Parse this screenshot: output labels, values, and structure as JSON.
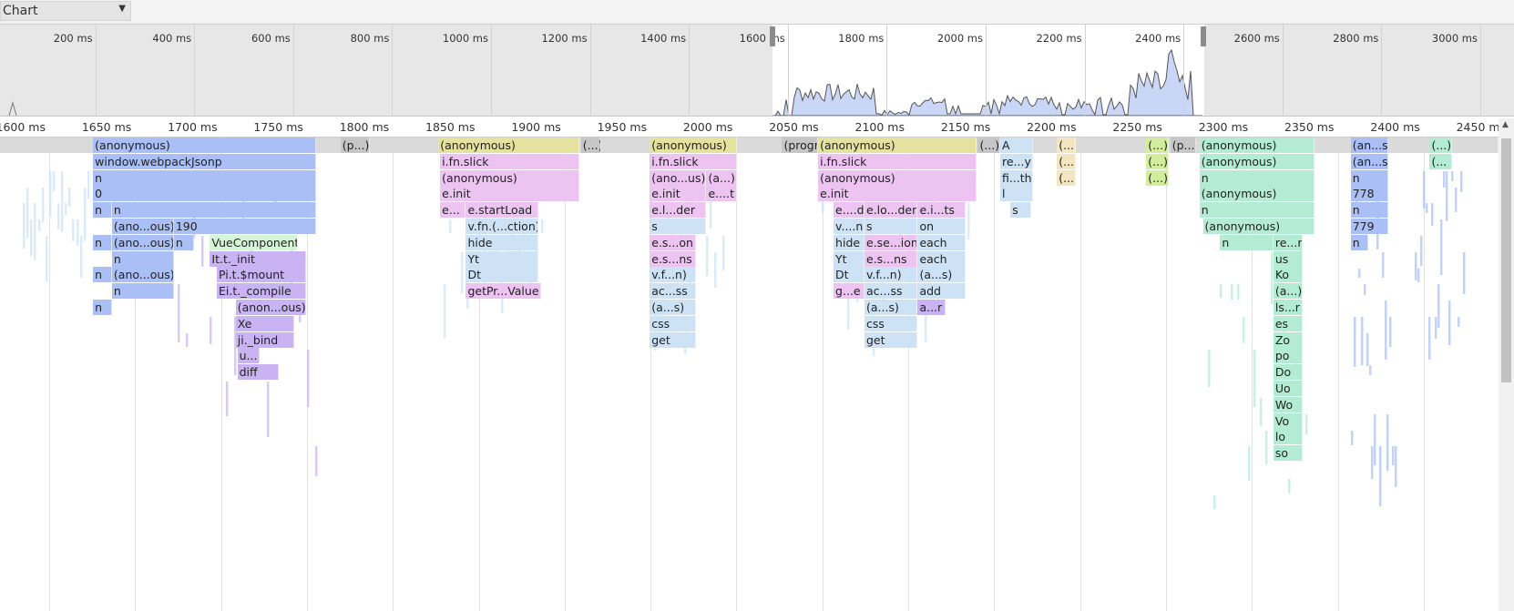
{
  "view_selector": {
    "label": "Chart",
    "icon": "dropdown-triangle-icon"
  },
  "overview": {
    "ticks": [
      "200 ms",
      "400 ms",
      "600 ms",
      "800 ms",
      "1000 ms",
      "1200 ms",
      "1400 ms",
      "1600 ms",
      "1800 ms",
      "2000 ms",
      "2200 ms",
      "2400 ms",
      "2600 ms",
      "2800 ms",
      "3000 ms"
    ],
    "selection_ms": [
      1630,
      2460
    ]
  },
  "ruler": {
    "ticks": [
      "1600 ms",
      "1650 ms",
      "1700 ms",
      "1750 ms",
      "1800 ms",
      "1850 ms",
      "1900 ms",
      "1950 ms",
      "2000 ms",
      "2050 ms",
      "2100 ms",
      "2150 ms",
      "2200 ms",
      "2250 ms",
      "2300 ms",
      "2350 ms",
      "2400 ms",
      "2450 ms"
    ]
  },
  "colors": {
    "blue": "#a9bff5",
    "purple": "#c9b3f2",
    "yellow": "#e5e2a0",
    "pink": "#edc3f2",
    "lightblue": "#cde3f5",
    "gray": "#c6c6c6",
    "green": "#b3ebd4",
    "mint": "#d6f5d6",
    "lime": "#d2ee9c",
    "tan": "#f3e5bf"
  },
  "flame": {
    "blocks": [
      {
        "text": "(anonymous)",
        "c": "blue",
        "s": 1651,
        "e": 1781,
        "d": 0
      },
      {
        "text": "window.webpackJsonp",
        "c": "blue",
        "s": 1651,
        "e": 1781,
        "d": 1
      },
      {
        "text": "n",
        "c": "blue",
        "s": 1651,
        "e": 1781,
        "d": 2
      },
      {
        "text": "0",
        "c": "blue",
        "s": 1651,
        "e": 1781,
        "d": 3
      },
      {
        "text": "n",
        "c": "blue",
        "s": 1651,
        "e": 1662,
        "d": 4
      },
      {
        "text": "n",
        "c": "blue",
        "s": 1662,
        "e": 1781,
        "d": 4
      },
      {
        "text": "(ano...ous)",
        "c": "blue",
        "s": 1662,
        "e": 1698,
        "d": 5
      },
      {
        "text": "190",
        "c": "blue",
        "s": 1698,
        "e": 1781,
        "d": 5
      },
      {
        "text": "n",
        "c": "blue",
        "s": 1651,
        "e": 1662,
        "d": 6
      },
      {
        "text": "(ano...ous)",
        "c": "blue",
        "s": 1662,
        "e": 1698,
        "d": 6
      },
      {
        "text": "n",
        "c": "blue",
        "s": 1698,
        "e": 1710,
        "d": 6
      },
      {
        "text": "VueComponent",
        "c": "mint",
        "s": 1719,
        "e": 1770,
        "d": 6
      },
      {
        "text": "n",
        "c": "blue",
        "s": 1662,
        "e": 1698,
        "d": 7
      },
      {
        "text": "It.t._init",
        "c": "purple",
        "s": 1719,
        "e": 1775,
        "d": 7
      },
      {
        "text": "n",
        "c": "blue",
        "s": 1651,
        "e": 1662,
        "d": 8
      },
      {
        "text": "(ano...ous)",
        "c": "blue",
        "s": 1662,
        "e": 1698,
        "d": 8
      },
      {
        "text": "Pi.t.$mount",
        "c": "purple",
        "s": 1723,
        "e": 1775,
        "d": 8
      },
      {
        "text": "n",
        "c": "blue",
        "s": 1662,
        "e": 1698,
        "d": 9
      },
      {
        "text": "Ei.t._compile",
        "c": "purple",
        "s": 1723,
        "e": 1775,
        "d": 9
      },
      {
        "text": "n",
        "c": "blue",
        "s": 1651,
        "e": 1662,
        "d": 10
      },
      {
        "text": "(anon...ous)",
        "c": "purple",
        "s": 1734,
        "e": 1775,
        "d": 10
      },
      {
        "text": "Xe",
        "c": "purple",
        "s": 1734,
        "e": 1768,
        "d": 11
      },
      {
        "text": "ji._bind",
        "c": "purple",
        "s": 1734,
        "e": 1768,
        "d": 12
      },
      {
        "text": "u...",
        "c": "purple",
        "s": 1735,
        "e": 1748,
        "d": 13
      },
      {
        "text": "diff",
        "c": "purple",
        "s": 1735,
        "e": 1759,
        "d": 14
      },
      {
        "text": "(p...)",
        "c": "gray",
        "s": 1795,
        "e": 1812,
        "d": 0
      },
      {
        "text": "(anonymous)",
        "c": "yellow",
        "s": 1852,
        "e": 1934,
        "d": 0
      },
      {
        "text": "i.fn.slick",
        "c": "pink",
        "s": 1853,
        "e": 1934,
        "d": 1
      },
      {
        "text": "(anonymous)",
        "c": "pink",
        "s": 1853,
        "e": 1934,
        "d": 2
      },
      {
        "text": "e.init",
        "c": "pink",
        "s": 1853,
        "e": 1934,
        "d": 3
      },
      {
        "text": "e...",
        "c": "pink",
        "s": 1853,
        "e": 1868,
        "d": 4
      },
      {
        "text": "e.startLoad",
        "c": "pink",
        "s": 1868,
        "e": 1910,
        "d": 4
      },
      {
        "text": "v.fn.(...ction)",
        "c": "lightblue",
        "s": 1868,
        "e": 1910,
        "d": 5
      },
      {
        "text": "hide",
        "c": "lightblue",
        "s": 1868,
        "e": 1910,
        "d": 6
      },
      {
        "text": "Yt",
        "c": "lightblue",
        "s": 1868,
        "e": 1910,
        "d": 7
      },
      {
        "text": "Dt",
        "c": "lightblue",
        "s": 1868,
        "e": 1910,
        "d": 8
      },
      {
        "text": "getPr...Value",
        "c": "pink",
        "s": 1868,
        "e": 1912,
        "d": 9
      },
      {
        "text": "(...)",
        "c": "gray",
        "s": 1935,
        "e": 1947,
        "d": 0
      },
      {
        "text": "(anonymous)",
        "c": "yellow",
        "s": 1975,
        "e": 2026,
        "d": 0
      },
      {
        "text": "i.fn.slick",
        "c": "pink",
        "s": 1975,
        "e": 2026,
        "d": 1
      },
      {
        "text": "(ano...us)",
        "c": "pink",
        "s": 1975,
        "e": 2008,
        "d": 2
      },
      {
        "text": "(a...)",
        "c": "pink",
        "s": 2008,
        "e": 2026,
        "d": 2
      },
      {
        "text": "e.init",
        "c": "pink",
        "s": 1975,
        "e": 2008,
        "d": 3
      },
      {
        "text": "e....t",
        "c": "pink",
        "s": 2008,
        "e": 2026,
        "d": 3
      },
      {
        "text": "e.l...der",
        "c": "pink",
        "s": 1975,
        "e": 2008,
        "d": 4
      },
      {
        "text": "s",
        "c": "lightblue",
        "s": 1975,
        "e": 2008,
        "d": 5
      },
      {
        "text": "e.s...on",
        "c": "pink",
        "s": 1975,
        "e": 2002,
        "d": 6
      },
      {
        "text": "e.s...ns",
        "c": "pink",
        "s": 1975,
        "e": 2002,
        "d": 7
      },
      {
        "text": "v.f...n)",
        "c": "lightblue",
        "s": 1975,
        "e": 2002,
        "d": 8
      },
      {
        "text": "ac...ss",
        "c": "lightblue",
        "s": 1975,
        "e": 2002,
        "d": 9
      },
      {
        "text": "(a...s)",
        "c": "lightblue",
        "s": 1975,
        "e": 2002,
        "d": 10
      },
      {
        "text": "css",
        "c": "lightblue",
        "s": 1975,
        "e": 2002,
        "d": 11
      },
      {
        "text": "get",
        "c": "lightblue",
        "s": 1975,
        "e": 2002,
        "d": 12
      },
      {
        "text": "(program)",
        "c": "gray",
        "s": 2052,
        "e": 2073,
        "d": 0
      },
      {
        "text": "(anonymous)",
        "c": "yellow",
        "s": 2073,
        "e": 2165,
        "d": 0
      },
      {
        "text": "i.fn.slick",
        "c": "pink",
        "s": 2073,
        "e": 2165,
        "d": 1
      },
      {
        "text": "(anonymous)",
        "c": "pink",
        "s": 2073,
        "e": 2165,
        "d": 2
      },
      {
        "text": "e.init",
        "c": "pink",
        "s": 2073,
        "e": 2165,
        "d": 3
      },
      {
        "text": "e....d",
        "c": "pink",
        "s": 2082,
        "e": 2100,
        "d": 4
      },
      {
        "text": "e.lo...der",
        "c": "pink",
        "s": 2100,
        "e": 2131,
        "d": 4
      },
      {
        "text": "e.i...ts",
        "c": "pink",
        "s": 2131,
        "e": 2159,
        "d": 4
      },
      {
        "text": "v....n)",
        "c": "lightblue",
        "s": 2082,
        "e": 2100,
        "d": 5
      },
      {
        "text": "s",
        "c": "lightblue",
        "s": 2100,
        "e": 2131,
        "d": 5
      },
      {
        "text": "on",
        "c": "lightblue",
        "s": 2131,
        "e": 2159,
        "d": 5
      },
      {
        "text": "hide",
        "c": "lightblue",
        "s": 2082,
        "e": 2100,
        "d": 6
      },
      {
        "text": "e.se...ion",
        "c": "pink",
        "s": 2100,
        "e": 2131,
        "d": 6
      },
      {
        "text": "each",
        "c": "lightblue",
        "s": 2131,
        "e": 2159,
        "d": 6
      },
      {
        "text": "Yt",
        "c": "lightblue",
        "s": 2082,
        "e": 2100,
        "d": 7
      },
      {
        "text": "e.s...ns",
        "c": "pink",
        "s": 2100,
        "e": 2131,
        "d": 7
      },
      {
        "text": "each",
        "c": "lightblue",
        "s": 2131,
        "e": 2159,
        "d": 7
      },
      {
        "text": "Dt",
        "c": "lightblue",
        "s": 2082,
        "e": 2100,
        "d": 8
      },
      {
        "text": "v.f...n)",
        "c": "lightblue",
        "s": 2100,
        "e": 2131,
        "d": 8
      },
      {
        "text": "(a...s)",
        "c": "lightblue",
        "s": 2131,
        "e": 2159,
        "d": 8
      },
      {
        "text": "g...e",
        "c": "pink",
        "s": 2082,
        "e": 2100,
        "d": 9
      },
      {
        "text": "ac...ss",
        "c": "lightblue",
        "s": 2100,
        "e": 2131,
        "d": 9
      },
      {
        "text": "add",
        "c": "lightblue",
        "s": 2131,
        "e": 2159,
        "d": 9
      },
      {
        "text": "(a...s)",
        "c": "lightblue",
        "s": 2100,
        "e": 2131,
        "d": 10
      },
      {
        "text": "a...r",
        "c": "purple",
        "s": 2131,
        "e": 2147,
        "d": 10
      },
      {
        "text": "css",
        "c": "lightblue",
        "s": 2100,
        "e": 2131,
        "d": 11
      },
      {
        "text": "get",
        "c": "lightblue",
        "s": 2100,
        "e": 2131,
        "d": 12
      },
      {
        "text": "(...)",
        "c": "gray",
        "s": 2166,
        "e": 2179,
        "d": 0
      },
      {
        "text": "A",
        "c": "lightblue",
        "s": 2179,
        "e": 2198,
        "d": 0
      },
      {
        "text": "re...y",
        "c": "lightblue",
        "s": 2179,
        "e": 2198,
        "d": 1
      },
      {
        "text": "fi...th",
        "c": "lightblue",
        "s": 2179,
        "e": 2198,
        "d": 2
      },
      {
        "text": "l",
        "c": "lightblue",
        "s": 2179,
        "e": 2198,
        "d": 3
      },
      {
        "text": "s",
        "c": "lightblue",
        "s": 2185,
        "e": 2197,
        "d": 4
      },
      {
        "text": "(...)",
        "c": "tan",
        "s": 2212,
        "e": 2223,
        "d": 0
      },
      {
        "text": "(...)",
        "c": "tan",
        "s": 2212,
        "e": 2223,
        "d": 1
      },
      {
        "text": "(...)",
        "c": "tan",
        "s": 2212,
        "e": 2223,
        "d": 2
      },
      {
        "text": "(...)",
        "c": "lime",
        "s": 2264,
        "e": 2277,
        "d": 0
      },
      {
        "text": "(...)",
        "c": "lime",
        "s": 2264,
        "e": 2277,
        "d": 1
      },
      {
        "text": "(...)",
        "c": "lime",
        "s": 2264,
        "e": 2277,
        "d": 2
      },
      {
        "text": "(p...)",
        "c": "gray",
        "s": 2278,
        "e": 2293,
        "d": 0
      },
      {
        "text": "(anonymous)",
        "c": "green",
        "s": 2295,
        "e": 2362,
        "d": 0
      },
      {
        "text": "(anonymous)",
        "c": "green",
        "s": 2295,
        "e": 2362,
        "d": 1
      },
      {
        "text": "n",
        "c": "green",
        "s": 2295,
        "e": 2362,
        "d": 2
      },
      {
        "text": "(anonymous)",
        "c": "green",
        "s": 2295,
        "e": 2362,
        "d": 3
      },
      {
        "text": "n",
        "c": "green",
        "s": 2295,
        "e": 2362,
        "d": 4
      },
      {
        "text": "(anonymous)",
        "c": "green",
        "s": 2297,
        "e": 2362,
        "d": 5
      },
      {
        "text": "n",
        "c": "green",
        "s": 2307,
        "e": 2338,
        "d": 6
      },
      {
        "text": "re...r",
        "c": "green",
        "s": 2338,
        "e": 2355,
        "d": 6
      },
      {
        "text": "us",
        "c": "green",
        "s": 2338,
        "e": 2355,
        "d": 7
      },
      {
        "text": "Ko",
        "c": "green",
        "s": 2338,
        "e": 2355,
        "d": 8
      },
      {
        "text": "(a...)",
        "c": "green",
        "s": 2338,
        "e": 2355,
        "d": 9
      },
      {
        "text": "ls...r",
        "c": "green",
        "s": 2338,
        "e": 2355,
        "d": 10
      },
      {
        "text": "es",
        "c": "green",
        "s": 2338,
        "e": 2355,
        "d": 11
      },
      {
        "text": "Zo",
        "c": "green",
        "s": 2338,
        "e": 2355,
        "d": 12
      },
      {
        "text": "po",
        "c": "green",
        "s": 2338,
        "e": 2355,
        "d": 13
      },
      {
        "text": "Do",
        "c": "green",
        "s": 2338,
        "e": 2355,
        "d": 14
      },
      {
        "text": "Uo",
        "c": "green",
        "s": 2338,
        "e": 2355,
        "d": 15
      },
      {
        "text": "Wo",
        "c": "green",
        "s": 2338,
        "e": 2355,
        "d": 16
      },
      {
        "text": "Vo",
        "c": "green",
        "s": 2338,
        "e": 2355,
        "d": 17
      },
      {
        "text": "lo",
        "c": "green",
        "s": 2338,
        "e": 2355,
        "d": 18
      },
      {
        "text": "so",
        "c": "green",
        "s": 2338,
        "e": 2355,
        "d": 19
      },
      {
        "text": "(an...s)",
        "c": "blue",
        "s": 2383,
        "e": 2405,
        "d": 0
      },
      {
        "text": "(an...s)",
        "c": "blue",
        "s": 2383,
        "e": 2405,
        "d": 1
      },
      {
        "text": "n",
        "c": "blue",
        "s": 2383,
        "e": 2405,
        "d": 2
      },
      {
        "text": "778",
        "c": "blue",
        "s": 2383,
        "e": 2405,
        "d": 3
      },
      {
        "text": "n",
        "c": "blue",
        "s": 2383,
        "e": 2405,
        "d": 4
      },
      {
        "text": "779",
        "c": "blue",
        "s": 2383,
        "e": 2405,
        "d": 5
      },
      {
        "text": "n",
        "c": "blue",
        "s": 2383,
        "e": 2393,
        "d": 6
      },
      {
        "text": "(...)",
        "c": "green",
        "s": 2429,
        "e": 2442,
        "d": 0
      },
      {
        "text": "(...",
        "c": "green",
        "s": 2429,
        "e": 2442,
        "d": 1
      }
    ]
  }
}
